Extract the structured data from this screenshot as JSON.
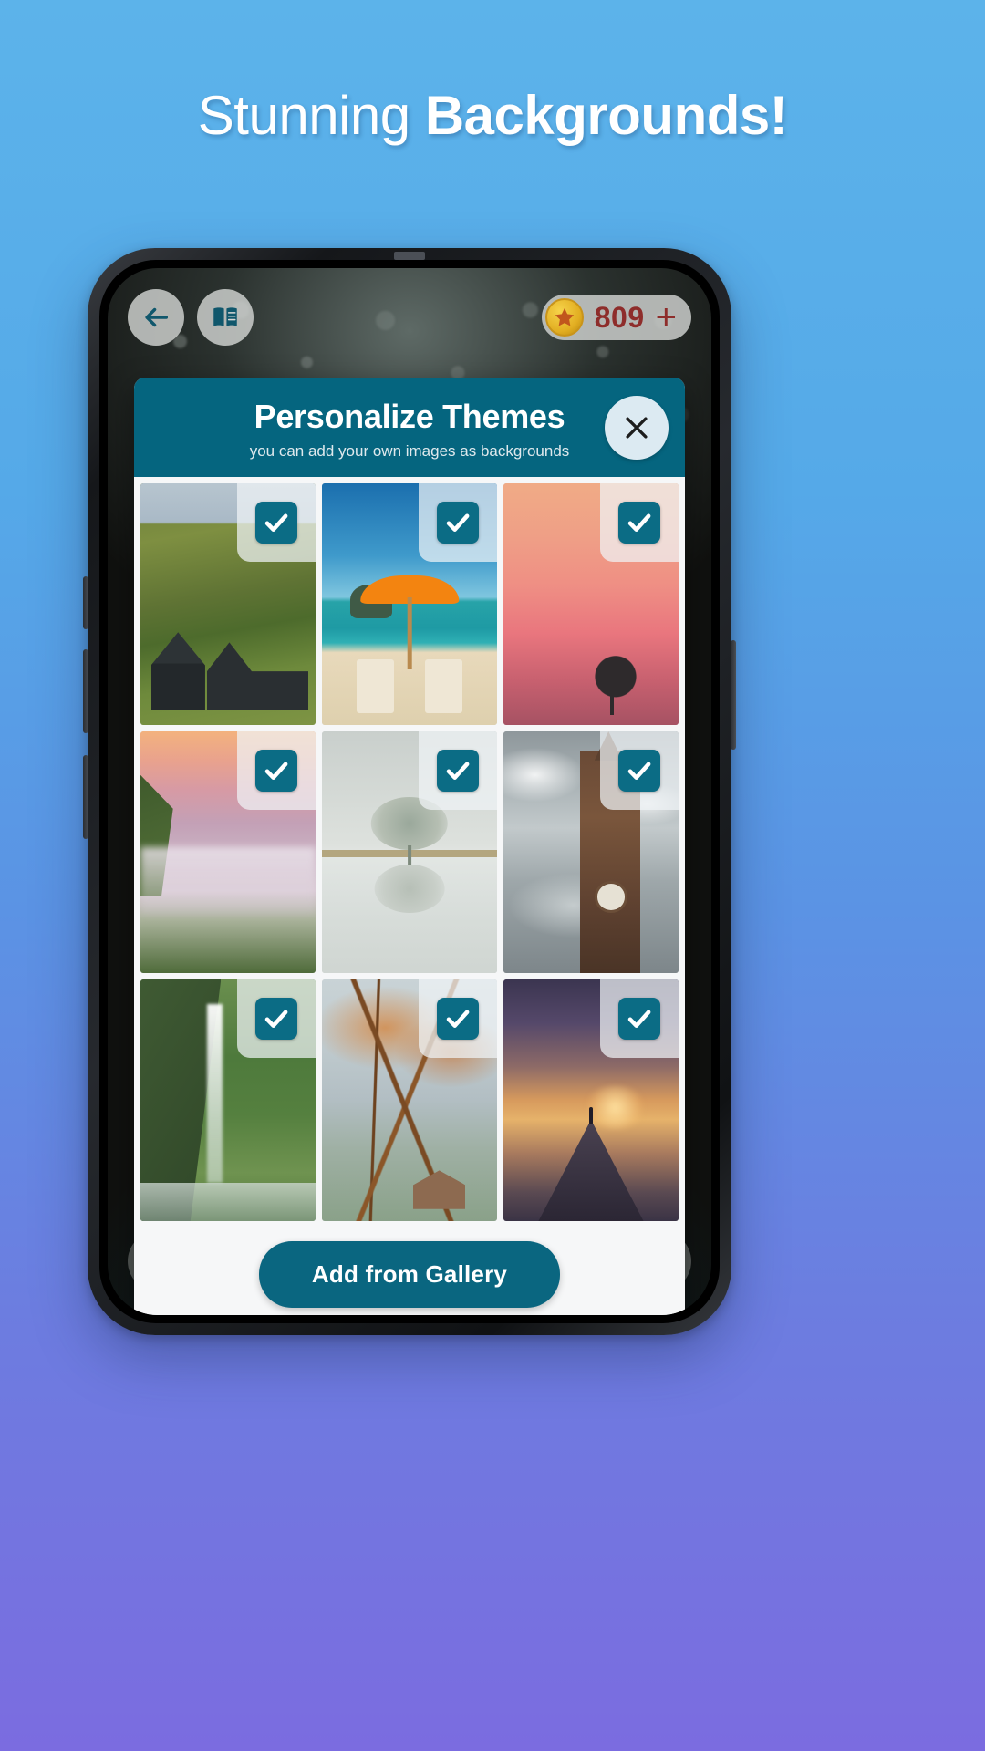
{
  "promo": {
    "headline_light": "Stunning ",
    "headline_bold": "Backgrounds!"
  },
  "app": {
    "topbar": {
      "back_icon": "back-arrow-icon",
      "book_icon": "book-icon",
      "coin_icon": "star-coin-icon",
      "coin_count": "809",
      "add_coins_label": "+"
    },
    "bottom": {
      "layers_icon": "layers-icon",
      "shuffle_icon": "shuffle-icon"
    }
  },
  "dialog": {
    "title": "Personalize Themes",
    "subtitle": "you can add your own images as backgrounds",
    "close_icon": "close-icon",
    "gallery_button": "Add from Gallery",
    "checkbox_icon": "checkmark-icon",
    "thumbnails": [
      {
        "name": "green-hillside-cabin",
        "art": "ph-hill",
        "checked": true
      },
      {
        "name": "beach-orange-umbrella",
        "art": "ph-beach",
        "checked": true
      },
      {
        "name": "pink-sunset-lone-tree",
        "art": "ph-sunset",
        "checked": true
      },
      {
        "name": "misty-valley-sunrise",
        "art": "ph-fog",
        "checked": true
      },
      {
        "name": "tree-water-reflection",
        "art": "ph-tree",
        "checked": true
      },
      {
        "name": "big-ben-clock-tower",
        "art": "ph-bigben",
        "checked": true
      },
      {
        "name": "waterfall-cliff",
        "art": "ph-fall",
        "checked": true
      },
      {
        "name": "autumn-tree-branches",
        "art": "ph-autumn",
        "checked": true
      },
      {
        "name": "mountain-peak-sunrise",
        "art": "ph-peak",
        "checked": true
      }
    ]
  },
  "colors": {
    "teal": "#05657f",
    "teal_button": "#0a6680",
    "checkbox": "#0b6c85",
    "coin_text": "#8e2d2b",
    "bg_blue": "#5cb3ea",
    "bg_purple": "#7b6ce0"
  }
}
